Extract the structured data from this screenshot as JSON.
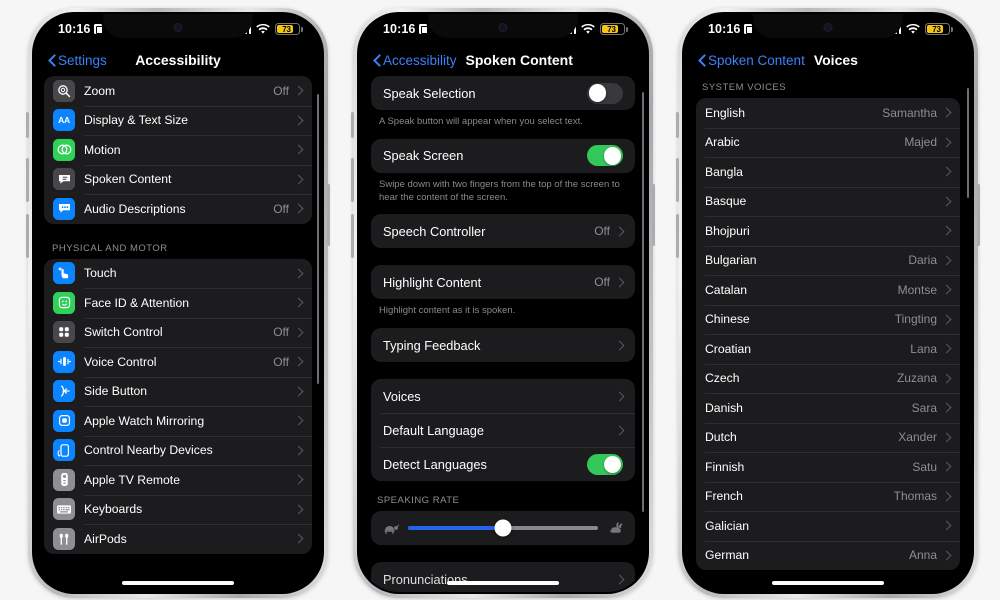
{
  "statusbar": {
    "time": "10:16",
    "battery_percent": "73",
    "lock_icon": "lock-portrait-icon",
    "cellular_icon": "cellular-bars-icon",
    "wifi_icon": "wifi-icon",
    "battery_icon": "battery-low-power-icon"
  },
  "phone1": {
    "nav": {
      "back_label": "Settings",
      "title": "Accessibility"
    },
    "groups": [
      {
        "header": "",
        "rows": [
          {
            "label": "Zoom",
            "value": "Off",
            "icon": "zoom-magnifier-icon",
            "icon_color": "#48484a",
            "chevron": true
          },
          {
            "label": "Display & Text Size",
            "value": "",
            "icon": "display-text-size-icon",
            "icon_color": "#0a84ff",
            "chevron": true
          },
          {
            "label": "Motion",
            "value": "",
            "icon": "motion-icon",
            "icon_color": "#30d158",
            "chevron": true
          },
          {
            "label": "Spoken Content",
            "value": "",
            "icon": "spoken-content-icon",
            "icon_color": "#48484a",
            "chevron": true
          },
          {
            "label": "Audio Descriptions",
            "value": "Off",
            "icon": "audio-descriptions-icon",
            "icon_color": "#0a84ff",
            "chevron": true
          }
        ]
      },
      {
        "header": "PHYSICAL AND MOTOR",
        "rows": [
          {
            "label": "Touch",
            "value": "",
            "icon": "touch-hand-icon",
            "icon_color": "#0a84ff",
            "chevron": true
          },
          {
            "label": "Face ID & Attention",
            "value": "",
            "icon": "face-id-icon",
            "icon_color": "#30d158",
            "chevron": true
          },
          {
            "label": "Switch Control",
            "value": "Off",
            "icon": "switch-control-icon",
            "icon_color": "#48484a",
            "chevron": true
          },
          {
            "label": "Voice Control",
            "value": "Off",
            "icon": "voice-control-icon",
            "icon_color": "#0a84ff",
            "chevron": true
          },
          {
            "label": "Side Button",
            "value": "",
            "icon": "side-button-icon",
            "icon_color": "#0a84ff",
            "chevron": true
          },
          {
            "label": "Apple Watch Mirroring",
            "value": "",
            "icon": "apple-watch-mirroring-icon",
            "icon_color": "#0a84ff",
            "chevron": true
          },
          {
            "label": "Control Nearby Devices",
            "value": "",
            "icon": "control-nearby-devices-icon",
            "icon_color": "#0a84ff",
            "chevron": true
          },
          {
            "label": "Apple TV Remote",
            "value": "",
            "icon": "apple-tv-remote-icon",
            "icon_color": "#8e8e93",
            "chevron": true
          },
          {
            "label": "Keyboards",
            "value": "",
            "icon": "keyboard-icon",
            "icon_color": "#8e8e93",
            "chevron": true
          },
          {
            "label": "AirPods",
            "value": "",
            "icon": "airpods-icon",
            "icon_color": "#8e8e93",
            "chevron": true
          }
        ]
      }
    ]
  },
  "phone2": {
    "nav": {
      "back_label": "Accessibility",
      "title": "Spoken Content"
    },
    "speak_selection": {
      "label": "Speak Selection",
      "toggle_on": false,
      "footnote": "A Speak button will appear when you select text."
    },
    "speak_screen": {
      "label": "Speak Screen",
      "toggle_on": true,
      "footnote": "Swipe down with two fingers from the top of the screen to hear the content of the screen."
    },
    "speech_controller": {
      "label": "Speech Controller",
      "value": "Off"
    },
    "highlight_content": {
      "label": "Highlight Content",
      "value": "Off",
      "footnote": "Highlight content as it is spoken."
    },
    "typing_feedback": {
      "label": "Typing Feedback",
      "value": ""
    },
    "voices_group": [
      {
        "label": "Voices",
        "value": "",
        "type": "chevron"
      },
      {
        "label": "Default Language",
        "value": "",
        "type": "chevron"
      },
      {
        "label": "Detect Languages",
        "value": "",
        "type": "toggle",
        "toggle_on": true
      }
    ],
    "speaking_rate": {
      "header": "SPEAKING RATE",
      "min_icon": "tortoise-icon",
      "max_icon": "hare-icon",
      "value_percent": 50
    },
    "pronunciations": {
      "label": "Pronunciations"
    }
  },
  "phone3": {
    "nav": {
      "back_label": "Spoken Content",
      "title": "Voices"
    },
    "section_header": "SYSTEM VOICES",
    "voices": [
      {
        "language": "English",
        "voice": "Samantha"
      },
      {
        "language": "Arabic",
        "voice": "Majed"
      },
      {
        "language": "Bangla",
        "voice": ""
      },
      {
        "language": "Basque",
        "voice": ""
      },
      {
        "language": "Bhojpuri",
        "voice": ""
      },
      {
        "language": "Bulgarian",
        "voice": "Daria"
      },
      {
        "language": "Catalan",
        "voice": "Montse"
      },
      {
        "language": "Chinese",
        "voice": "Tingting"
      },
      {
        "language": "Croatian",
        "voice": "Lana"
      },
      {
        "language": "Czech",
        "voice": "Zuzana"
      },
      {
        "language": "Danish",
        "voice": "Sara"
      },
      {
        "language": "Dutch",
        "voice": "Xander"
      },
      {
        "language": "Finnish",
        "voice": "Satu"
      },
      {
        "language": "French",
        "voice": "Thomas"
      },
      {
        "language": "Galician",
        "voice": ""
      },
      {
        "language": "German",
        "voice": "Anna"
      }
    ]
  },
  "colors": {
    "background": "#f6f6f6",
    "screen_bg": "#000000",
    "group_bg": "#1c1c1e",
    "accent_blue": "#3b82f6",
    "toggle_on_green": "#34c759",
    "slider_blue": "#2563eb",
    "secondary_text": "#8e8e93",
    "battery_yellow": "#f5c518"
  }
}
